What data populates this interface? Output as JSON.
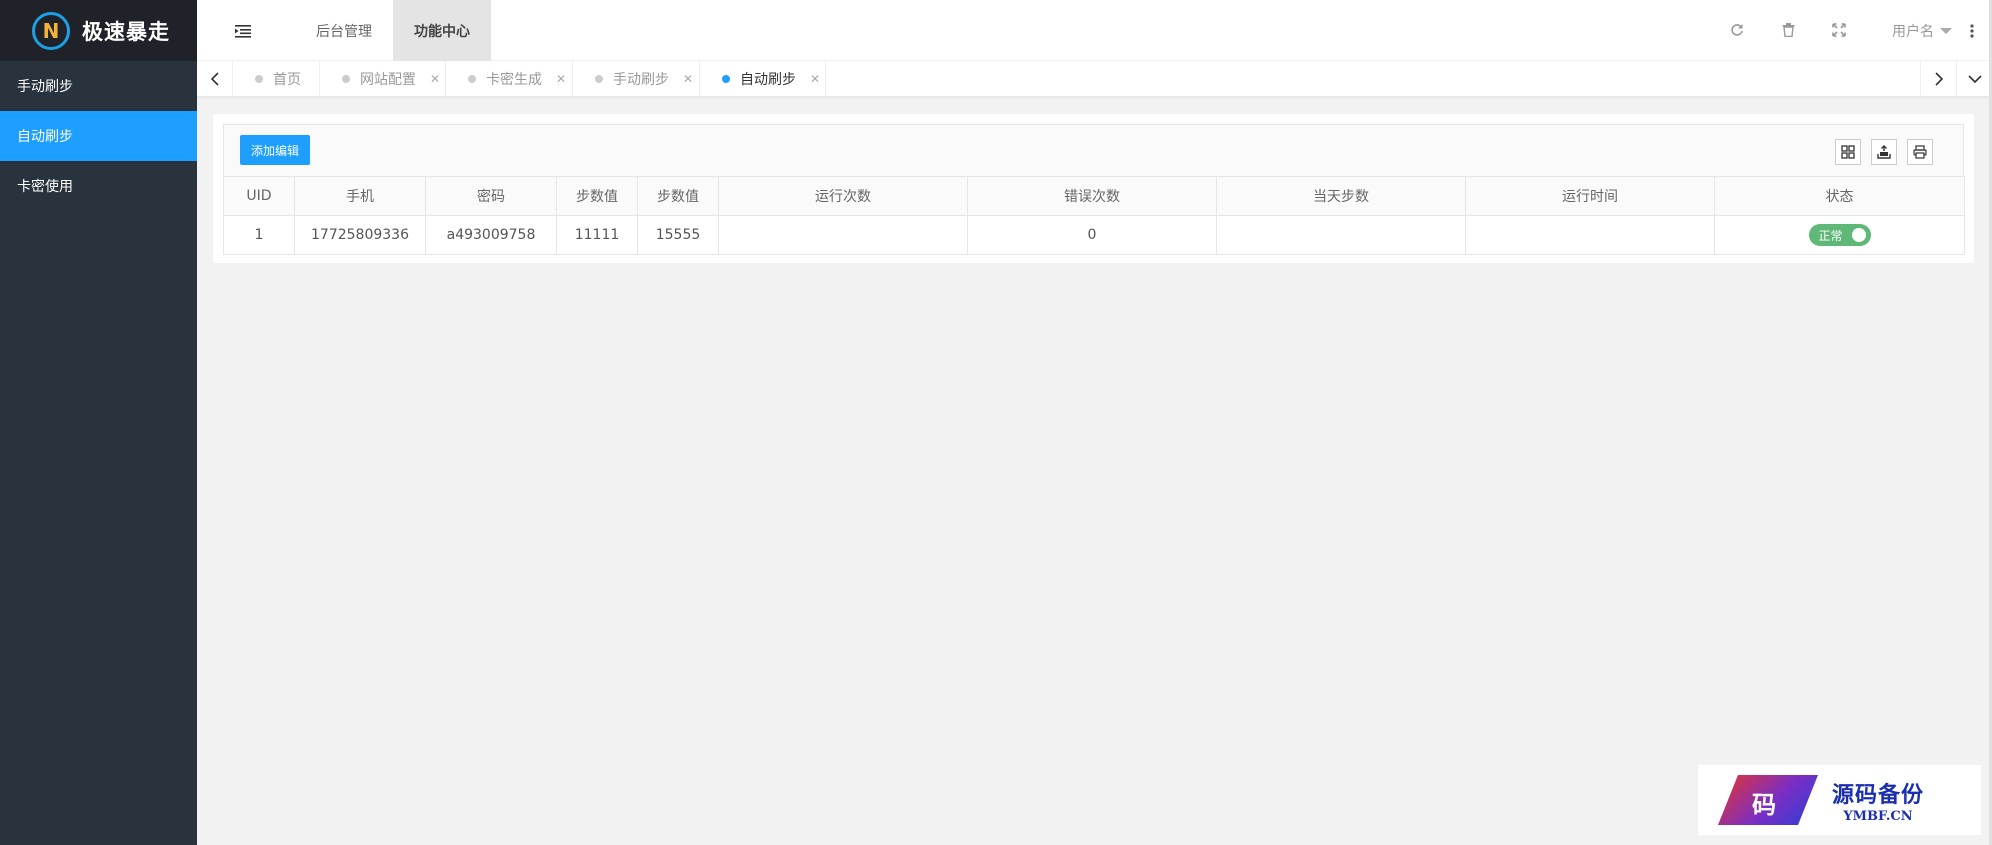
{
  "app": {
    "logo_char": "N",
    "logo_text": "极速暴走"
  },
  "sidebar": {
    "items": [
      {
        "label": "手动刷步",
        "active": false
      },
      {
        "label": "自动刷步",
        "active": true
      },
      {
        "label": "卡密使用",
        "active": false
      }
    ]
  },
  "header": {
    "menu_toggle_icon": "indent-icon",
    "nav": [
      {
        "label": "后台管理",
        "current": false
      },
      {
        "label": "功能中心",
        "current": true
      }
    ],
    "tools": [
      "refresh-icon",
      "trash-icon",
      "fullscreen-icon"
    ],
    "username": "用户名",
    "more_icon": "more-vertical-icon"
  },
  "tabs": [
    {
      "label": "首页",
      "closable": false,
      "active": false
    },
    {
      "label": "网站配置",
      "closable": true,
      "active": false
    },
    {
      "label": "卡密生成",
      "closable": true,
      "active": false
    },
    {
      "label": "手动刷步",
      "closable": true,
      "active": false
    },
    {
      "label": "自动刷步",
      "closable": true,
      "active": true
    }
  ],
  "toolbar": {
    "add_label": "添加编辑",
    "icons": [
      "columns-icon",
      "export-icon",
      "print-icon"
    ]
  },
  "table": {
    "columns": [
      "UID",
      "手机",
      "密码",
      "步数值",
      "步数值",
      "运行次数",
      "错误次数",
      "当天步数",
      "运行时间",
      "状态"
    ],
    "rows": [
      {
        "uid": "1",
        "phone": "17725809336",
        "password": "a493009758",
        "steps_min": "11111",
        "steps_max": "15555",
        "run_count": "",
        "error_count": "0",
        "today_steps": "",
        "run_time": "",
        "status": "正常",
        "status_on": true
      }
    ]
  },
  "watermark": {
    "logo_char": "码",
    "cn": "源码备份",
    "en": "YMBF.CN"
  },
  "colors": {
    "sidebar_bg": "#28333e",
    "logo_bg": "#20222a",
    "accent": "#1e9fff",
    "switch_on": "#5fb878"
  }
}
